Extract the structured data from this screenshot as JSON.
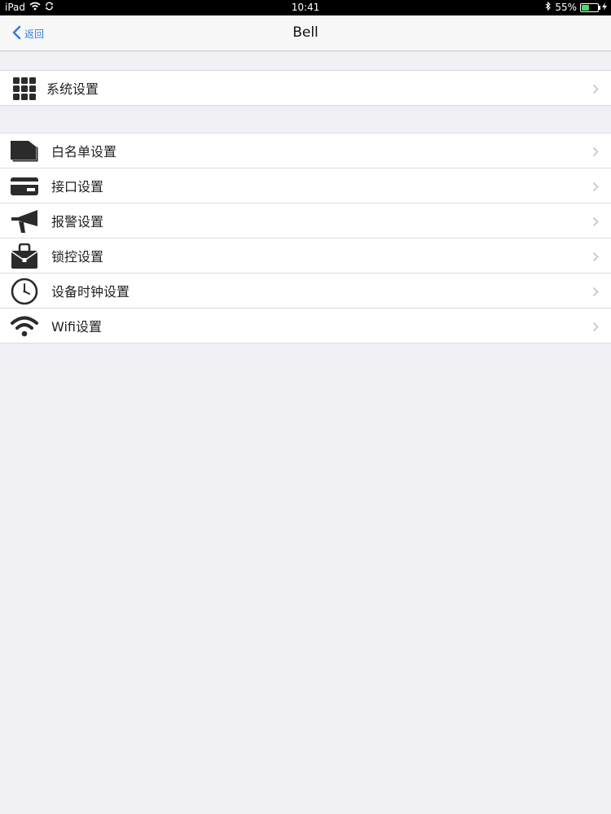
{
  "status_bar": {
    "device": "iPad",
    "time": "10:41",
    "battery": "55%",
    "battery_level": 0.55
  },
  "nav": {
    "back_label": "返回",
    "title": "Bell"
  },
  "sections": [
    {
      "items": [
        {
          "label": "系统设置",
          "icon": "grid-icon"
        }
      ]
    },
    {
      "items": [
        {
          "label": "白名单设置",
          "icon": "folder-stack-icon"
        },
        {
          "label": "接口设置",
          "icon": "card-icon"
        },
        {
          "label": "报警设置",
          "icon": "megaphone-icon"
        },
        {
          "label": "锁控设置",
          "icon": "lock-bag-icon"
        },
        {
          "label": "设备时钟设置",
          "icon": "clock-icon"
        },
        {
          "label": "Wifi设置",
          "icon": "wifi-icon"
        }
      ]
    }
  ],
  "colors": {
    "accent": "#2f7de1",
    "background": "#efeff4",
    "icon": "#2b2b2b"
  }
}
